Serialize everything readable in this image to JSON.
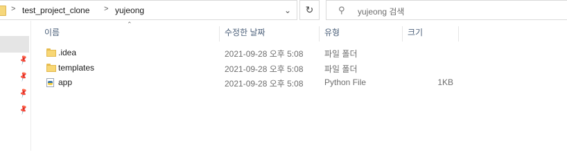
{
  "address": {
    "crumbs": [
      "test_project_clone",
      "yujeong"
    ],
    "separator": ">"
  },
  "search": {
    "placeholder": "yujeong 검색"
  },
  "columns": {
    "name": "이름",
    "date": "수정한 날짜",
    "type": "유형",
    "size": "크기"
  },
  "files": [
    {
      "icon": "folder-icon",
      "name": ".idea",
      "date": "2021-09-28 오후 5:08",
      "type": "파일 폴더",
      "size": ""
    },
    {
      "icon": "folder-icon",
      "name": "templates",
      "date": "2021-09-28 오후 5:08",
      "type": "파일 폴더",
      "size": ""
    },
    {
      "icon": "python-file-icon",
      "name": "app",
      "date": "2021-09-28 오후 5:08",
      "type": "Python File",
      "size": "1KB"
    }
  ]
}
